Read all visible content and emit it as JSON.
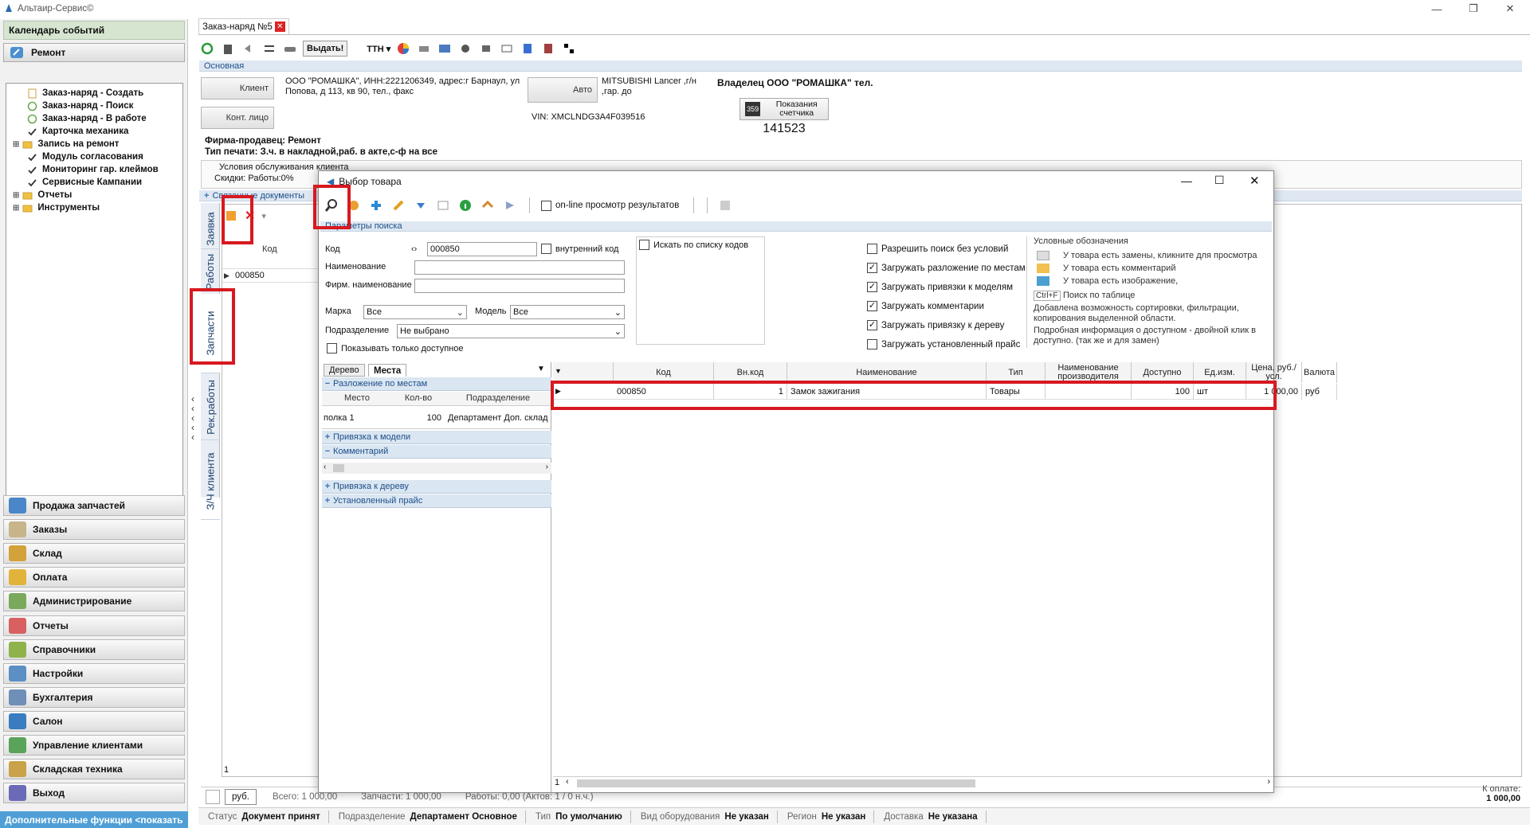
{
  "app": {
    "title": "Альтаир-Сервис©"
  },
  "left_panel": {
    "calendar": "Календарь событий",
    "section": "Ремонт",
    "tree": [
      {
        "label": "Заказ-наряд - Создать",
        "icon": "doc-icon"
      },
      {
        "label": "Заказ-наряд - Поиск",
        "icon": "circle-icon"
      },
      {
        "label": "Заказ-наряд - В работе",
        "icon": "circle-icon"
      },
      {
        "label": "Карточка механика",
        "icon": "check-icon"
      },
      {
        "label": "Запись на ремонт",
        "icon": "folder-icon"
      },
      {
        "label": "Модуль согласования",
        "icon": "check-icon"
      },
      {
        "label": "Мониторинг гар. клеймов",
        "icon": "check-icon"
      },
      {
        "label": "Сервисные Кампании",
        "icon": "check-icon"
      },
      {
        "label": "Отчеты",
        "icon": "folder-icon"
      },
      {
        "label": "Инструменты",
        "icon": "folder-icon"
      }
    ],
    "nav": [
      {
        "label": "Продажа запчастей",
        "color": "#4a86c8"
      },
      {
        "label": "Заказы",
        "color": "#c8b48a"
      },
      {
        "label": "Склад",
        "color": "#d4a23a"
      },
      {
        "label": "Оплата",
        "color": "#e1b33a"
      },
      {
        "label": "Администрирование",
        "color": "#7aa95c"
      },
      {
        "label": "Отчеты",
        "color": "#d86060"
      },
      {
        "label": "Справочники",
        "color": "#8fb24a"
      },
      {
        "label": "Настройки",
        "color": "#5c8fc4"
      },
      {
        "label": "Бухгалтерия",
        "color": "#6d8fb8"
      },
      {
        "label": "Салон",
        "color": "#3a7cc0"
      },
      {
        "label": "Управление клиентами",
        "color": "#5aa35a"
      },
      {
        "label": "Складская техника",
        "color": "#c9a24a"
      },
      {
        "label": "Выход",
        "color": "#6a6ab8"
      }
    ],
    "bottom_link": "Дополнительные функции <показать"
  },
  "doc": {
    "tab": "Заказ-наряд №5",
    "toolbar_vydat": "Выдать!",
    "toolbar_ttn": "ТТН",
    "section_main": "Основная",
    "client_btn": "Клиент",
    "client_info": "ООО \"РОМАШКА\", ИНН:2221206349, адрес:г Барнаул, ул Попова, д 113, кв 90, тел., факс",
    "contact_btn": "Конт. лицо",
    "auto_btn": "Авто",
    "auto_info": "MITSUBISHI Lancer ,г/н ,гар. до",
    "vin": "VIN: XMCLNDG3A4F039516",
    "owner": "Владелец  ООО \"РОМАШКА\" тел.",
    "counter_label": "Показания счетчика",
    "counter_value": "141523",
    "firm": "Фирма-продавец: Ремонт",
    "print_type": "Тип печати: З.ч. в накладной,раб. в акте,с-ф на все",
    "conditions": "Условия обслуживания клиента",
    "discounts": "Скидки:    Работы:0%",
    "linked_docs": "Связанные документы",
    "vtabs": [
      "Заявка",
      "Работы",
      "Запчасти",
      "Рек.работы",
      "З/Ч клиента"
    ],
    "grid_kod_header": "Код",
    "grid_row": "000850",
    "page_num": "1",
    "currency_btn": "руб.",
    "total": "Всего: 1 000,00",
    "parts": "Запчасти: 1 000,00",
    "works": "Работы: 0,00 (Актов: 1 / 0 н.ч.)",
    "to_pay_label": "К оплате:",
    "to_pay_value": "1 000,00"
  },
  "status": [
    {
      "label": "Статус",
      "value": "Документ принят"
    },
    {
      "label": "Подразделение",
      "value": "Департамент Основное"
    },
    {
      "label": "Тип",
      "value": "По умолчанию"
    },
    {
      "label": "Вид оборудования",
      "value": "Не указан"
    },
    {
      "label": "Регион",
      "value": "Не указан"
    },
    {
      "label": "Доставка",
      "value": "Не указана"
    }
  ],
  "dialog": {
    "title": "Выбор товара",
    "online": "on-line просмотр результатов",
    "search_params": "Параметры поиска",
    "kod_label": "Код",
    "kod_value": "000850",
    "internal_code": "внутренний код",
    "name_label": "Наименование",
    "firm_name_label": "Фирм. наименование",
    "brand_label": "Марка",
    "brand_value": "Все",
    "model_label": "Модель",
    "model_value": "Все",
    "dept_label": "Подразделение",
    "dept_value": "Не выбрано",
    "only_available": "Показывать только доступное",
    "search_by_list": "Искать по списку кодов",
    "options": [
      {
        "label": "Разрешить поиск без условий",
        "checked": false
      },
      {
        "label": "Загружать разложение по местам",
        "checked": true
      },
      {
        "label": "Загружать привязки к моделям",
        "checked": true
      },
      {
        "label": "Загружать комментарии",
        "checked": true
      },
      {
        "label": "Загружать привязку к дереву",
        "checked": true
      },
      {
        "label": "Загружать установленный прайс",
        "checked": false
      }
    ],
    "legend_title": "Условные обозначения",
    "legend": [
      "У товара есть замены, кликните для просмотра",
      "У товара есть комментарий",
      "У товара есть изображение,",
      "Поиск по таблице",
      "Добавлена возможность сортировки, фильтрации, копирования выделенной области.",
      "Подробная информация о доступном - двойной клик в доступно. (так же и для замен)"
    ],
    "ctrlf": "Ctrl+F",
    "side_tabs": [
      "Дерево",
      "Места"
    ],
    "places_header": "Разложение по местам",
    "places_cols": [
      "Место",
      "Кол-во",
      "Подразделение"
    ],
    "places_row": [
      "полка 1",
      "100",
      "Департамент Доп. склад"
    ],
    "model_bind": "Привязка к модели",
    "comment": "Комментарий",
    "tree_bind": "Привязка к дереву",
    "price_set": "Установленный прайс",
    "grid_cols": [
      "Код",
      "Вн.код",
      "Наименование",
      "Тип",
      "Наименование производителя",
      "Доступно",
      "Ед.изм.",
      "Цена, руб./усл.",
      "Валюта"
    ],
    "grid_row": [
      "000850",
      "1",
      "Замок зажигания",
      "Товары",
      "",
      "100",
      "шт",
      "1 000,00",
      "руб"
    ],
    "page_num": "1"
  }
}
